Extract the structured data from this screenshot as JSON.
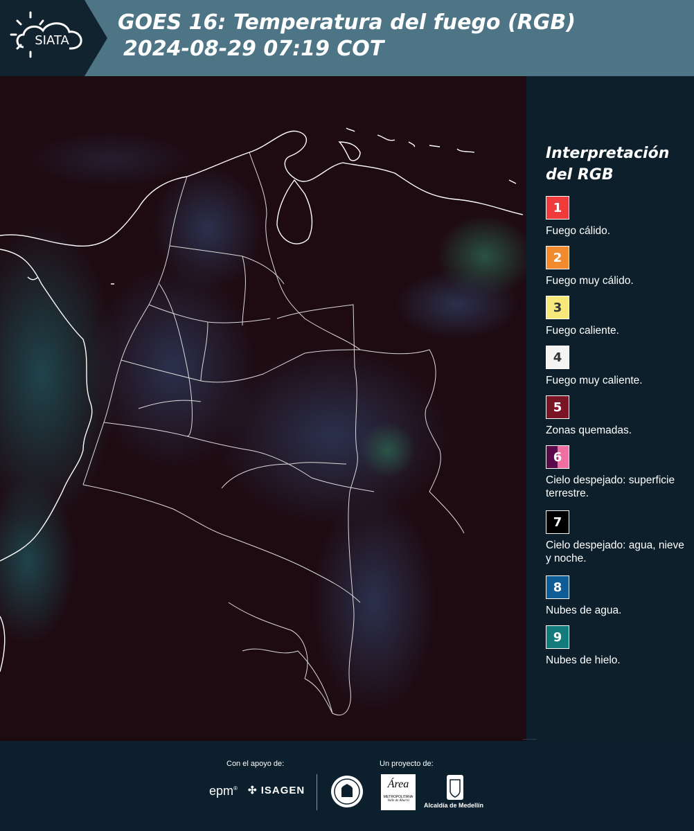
{
  "header": {
    "logo_text": "SIATA",
    "title_line1": "GOES 16: Temperatura del fuego (RGB)",
    "title_line2": "2024-08-29 07:19 COT"
  },
  "legend": {
    "title": "Interpretación del RGB",
    "items": [
      {
        "number": "1",
        "label": "Fuego cálido.",
        "color": "#ef3b3b",
        "text_color": "#ffffff"
      },
      {
        "number": "2",
        "label": "Fuego muy cálido.",
        "color": "#f28a2e",
        "text_color": "#ffffff"
      },
      {
        "number": "3",
        "label": "Fuego caliente.",
        "color": "#f7e87a",
        "text_color": "#333333"
      },
      {
        "number": "4",
        "label": "Fuego muy caliente.",
        "color": "#f4f4f4",
        "text_color": "#333333"
      },
      {
        "number": "5",
        "label": "Zonas quemadas.",
        "color": "#7b1526",
        "text_color": "#ffffff"
      },
      {
        "number": "6",
        "label": "Cielo despejado: superficie terrestre.",
        "color": "#5a0a4a",
        "color2": "#ef6fa0",
        "text_color": "#ffffff"
      },
      {
        "number": "7",
        "label": "Cielo despejado: agua, nieve y noche.",
        "color": "#000000",
        "text_color": "#ffffff"
      },
      {
        "number": "8",
        "label": "Nubes de agua.",
        "color": "#0f5c96",
        "text_color": "#ffffff"
      },
      {
        "number": "9",
        "label": "Nubes de hielo.",
        "color": "#127b7b",
        "text_color": "#ffffff"
      }
    ]
  },
  "footer": {
    "support_label": "Con el apoyo de:",
    "project_label": "Un proyecto de:",
    "sponsor_epm": "epm",
    "sponsor_isagen": "ISAGEN",
    "sponsor_area_top": "Área",
    "sponsor_area_bottom": "METROPOLITANA",
    "sponsor_area_sub": "Valle de Aburrá",
    "sponsor_alcaldia": "Alcaldía de Medellín"
  }
}
